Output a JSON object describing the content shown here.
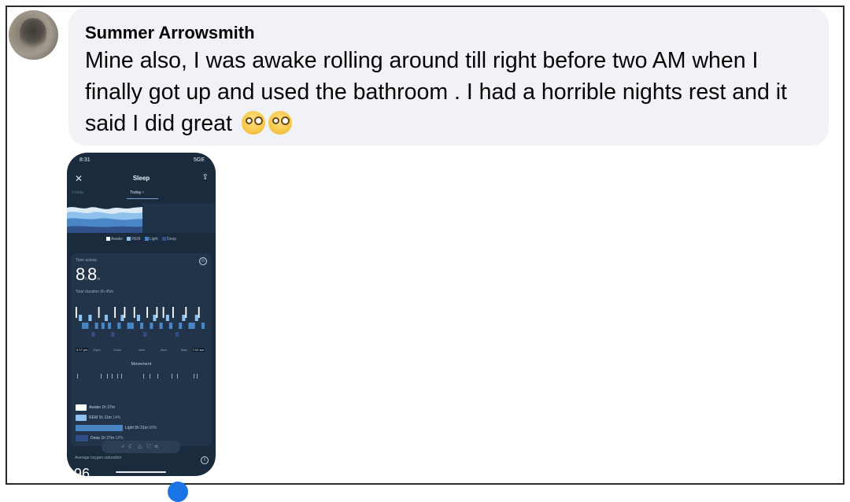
{
  "comment": {
    "author": "Summer Arrowsmith",
    "text": "Mine also, I was awake rolling around till right before two AM when I finally got up and used the bathroom . I had a horrible nights rest and it said I did great",
    "emojis": [
      "face-with-monocle-icon",
      "face-with-monocle-icon"
    ]
  },
  "phone": {
    "status": {
      "time": "8:31",
      "signal": "5GE"
    },
    "header": {
      "title": "Sleep"
    },
    "tabs": {
      "previous": "Friday",
      "current": "Today"
    },
    "legend": [
      {
        "label": "Awake",
        "color": "#ffffff"
      },
      {
        "label": "REM",
        "color": "#8fc1ef"
      },
      {
        "label": "Light",
        "color": "#4a86c5"
      },
      {
        "label": "Deep",
        "color": "#2f4f86"
      }
    ],
    "summary": {
      "label": "Time asleep",
      "hours": "8",
      "hours_unit": "h",
      "minutes": "8",
      "minutes_unit": "m",
      "total": "Total duration 9h 45m"
    },
    "timeline": {
      "start": "9:17 pm",
      "ticks": [
        "11pm",
        "12am",
        "2am",
        "4am",
        "5am"
      ],
      "end": "7:02 am"
    },
    "movement_label": "Movement",
    "stages": [
      {
        "name": "Awake",
        "duration": "1h 37m",
        "pct": "",
        "share": 0.1
      },
      {
        "name": "REM",
        "duration": "1h 11m",
        "pct": "14%",
        "share": 0.14
      },
      {
        "name": "Light",
        "duration": "5h 31m",
        "pct": "68%",
        "share": 0.68
      },
      {
        "name": "Deep",
        "duration": "1h 27m",
        "pct": "18%",
        "share": 0.18
      }
    ],
    "oxygen_label": "Average oxygen saturation",
    "oxygen_value": "96"
  }
}
